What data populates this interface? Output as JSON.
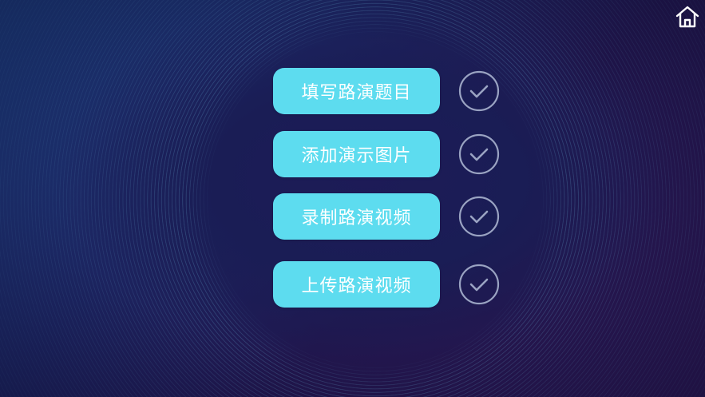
{
  "icons": {
    "home": "home-icon",
    "check": "check-circle-icon"
  },
  "colors": {
    "button_bg": "#5ddcef",
    "button_text": "#ffffff",
    "check_stroke": "#9aa3c2",
    "background_top_left": "#1b3b7a",
    "background_bottom_right": "#2a1650"
  },
  "steps": [
    {
      "label": "填写路演题目",
      "completed": true
    },
    {
      "label": "添加演示图片",
      "completed": true
    },
    {
      "label": "录制路演视频",
      "completed": true
    },
    {
      "label": "上传路演视频",
      "completed": true
    }
  ]
}
